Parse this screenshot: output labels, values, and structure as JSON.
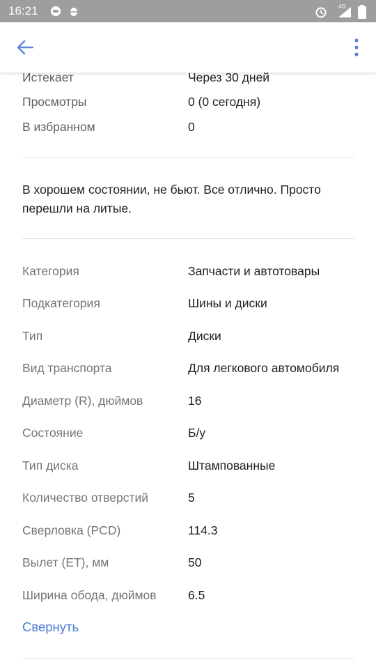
{
  "status_bar": {
    "time": "16:21",
    "network": "4G"
  },
  "top_rows": [
    {
      "label": "Истекает",
      "value": "Через 30 дней"
    },
    {
      "label": "Просмотры",
      "value": "0 (0 сегодня)"
    },
    {
      "label": "В избранном",
      "value": "0"
    }
  ],
  "description": "В хорошем состоянии, не бьют. Все отлично. Просто перешли на литые.",
  "attributes": [
    {
      "label": "Категория",
      "value": "Запчасти и автотовары"
    },
    {
      "label": "Подкатегория",
      "value": "Шины и диски"
    },
    {
      "label": "Тип",
      "value": "Диски"
    },
    {
      "label": "Вид транспорта",
      "value": "Для легкового автомобиля"
    },
    {
      "label": "Диаметр (R), дюймов",
      "value": "16"
    },
    {
      "label": "Состояние",
      "value": "Б/у"
    },
    {
      "label": "Тип диска",
      "value": "Штампованные"
    },
    {
      "label": "Количество отверстий",
      "value": "5"
    },
    {
      "label": "Сверловка (PCD)",
      "value": "114.3"
    },
    {
      "label": "Вылет (ET), мм",
      "value": "50"
    },
    {
      "label": "Ширина обода, дюймов",
      "value": "6.5"
    }
  ],
  "collapse_label": "Свернуть",
  "colors": {
    "accent": "#4a7bd0",
    "status_bar": "#9e9e9e"
  }
}
